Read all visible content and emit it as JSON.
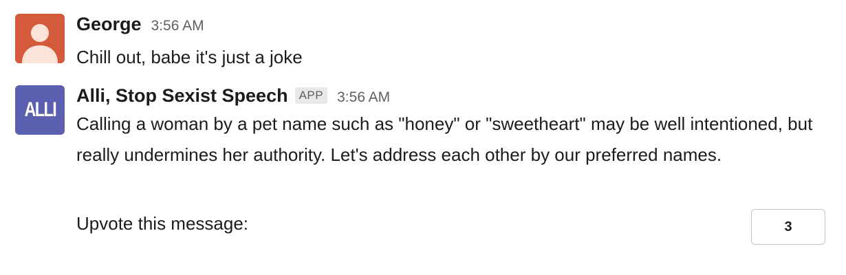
{
  "messages": [
    {
      "sender": "George",
      "timestamp": "3:56 AM",
      "text": "Chill out, babe it's just a joke",
      "avatar_color": "#d45a3c",
      "avatar_icon": "user-silhouette-icon"
    },
    {
      "sender": "Alli, Stop Sexist Speech",
      "badge": "APP",
      "timestamp": "3:56 AM",
      "avatar_text": "ALLI",
      "avatar_color": "#5b5fb0",
      "text": "Calling a woman by a pet name such as \"honey\" or \"sweetheart\" may be well intentioned, but really undermines her authority. Let's address each other by our preferred names.",
      "upvote_label": "Upvote this message:",
      "upvote_count": "3"
    }
  ]
}
